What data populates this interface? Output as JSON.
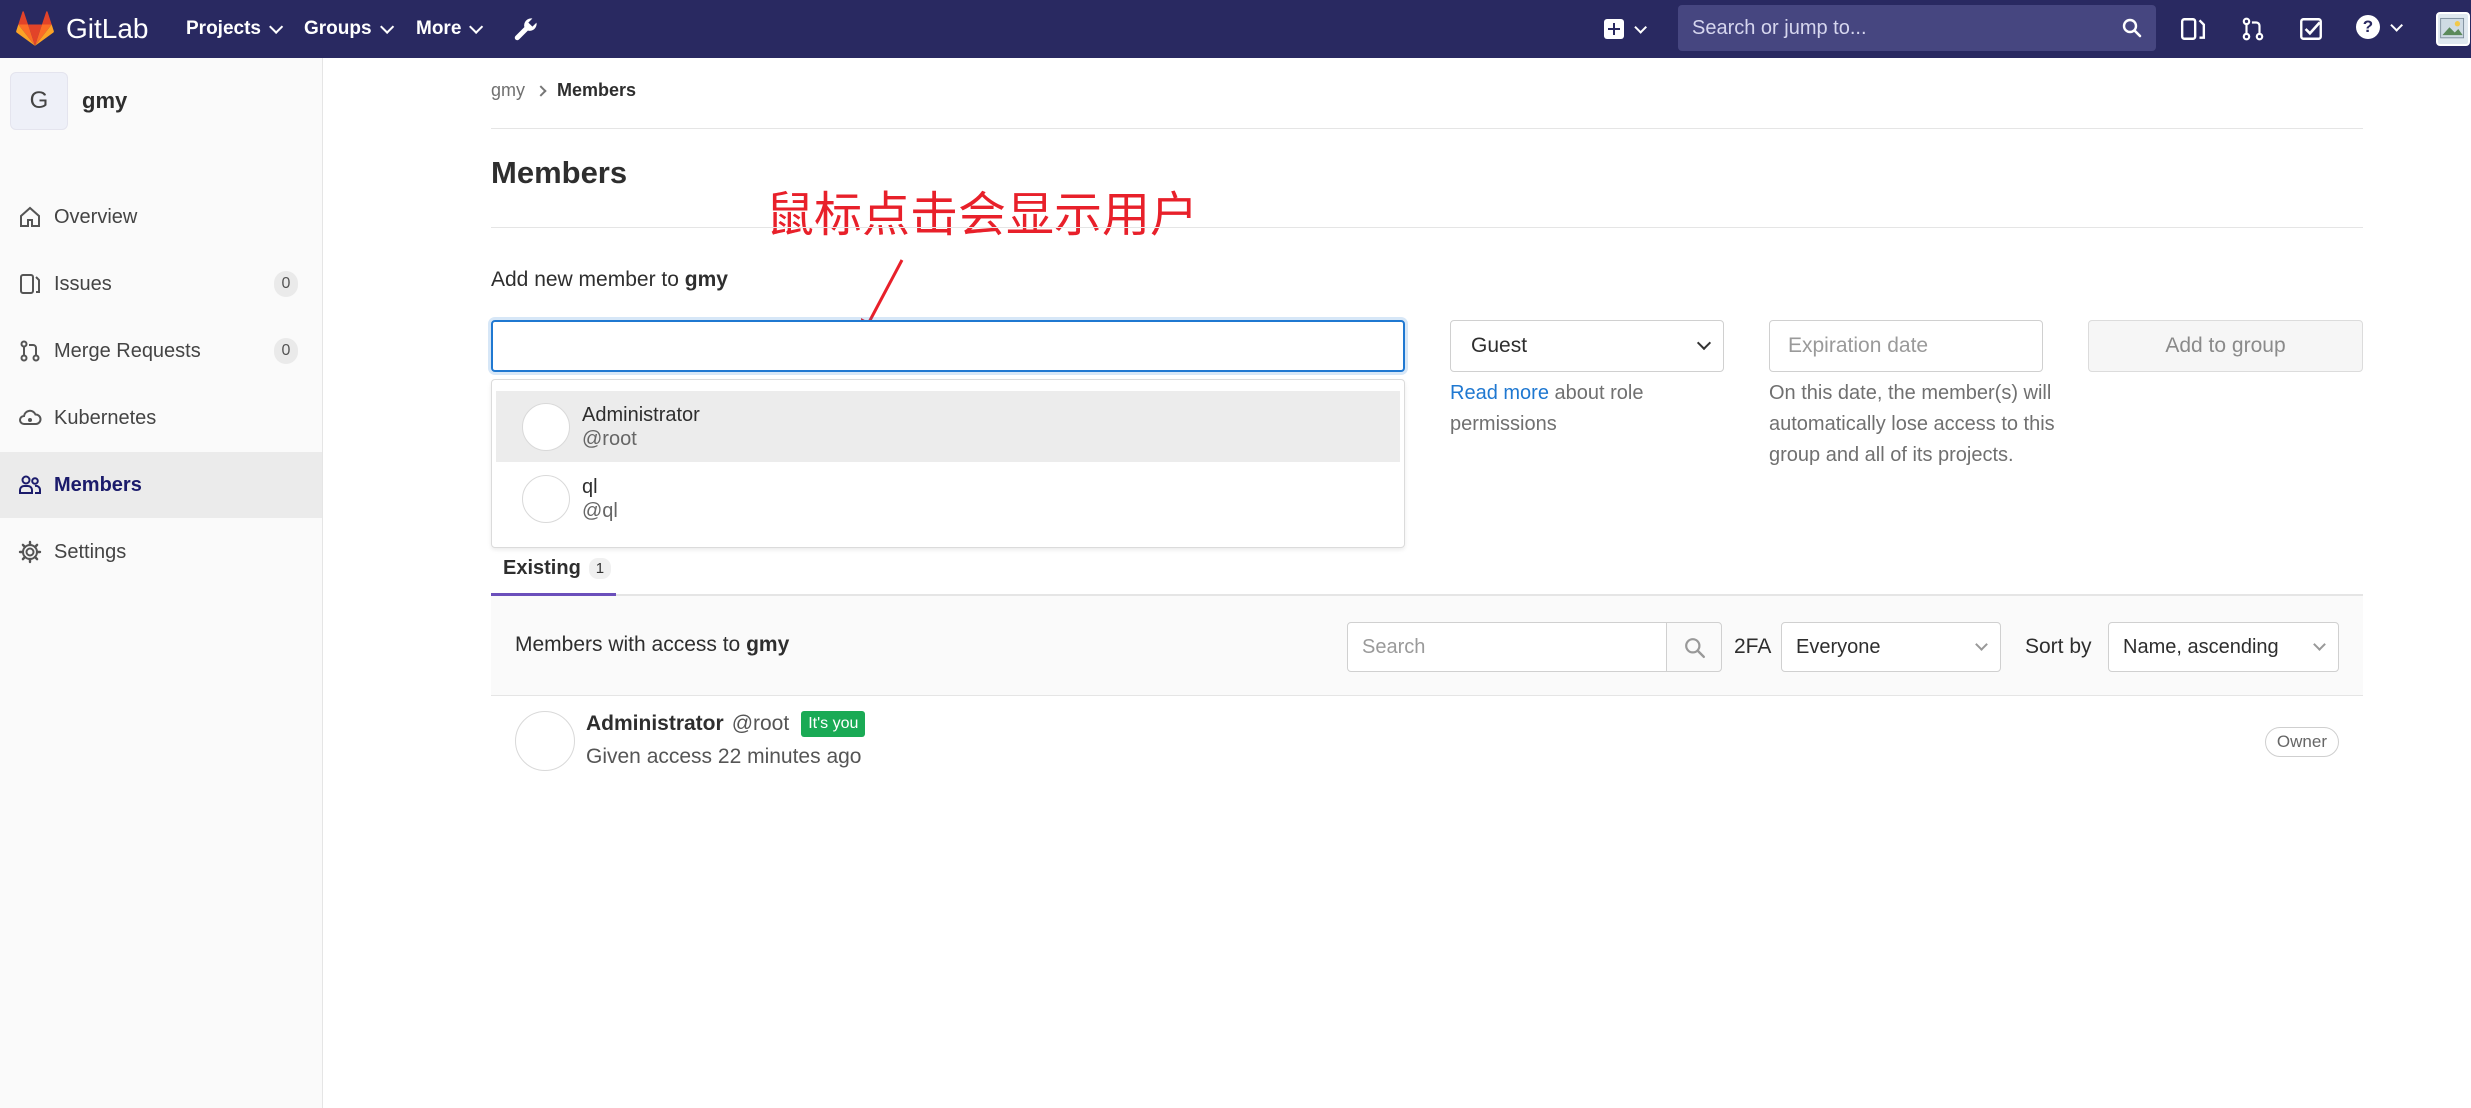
{
  "navbar": {
    "brand": "GitLab",
    "projects": "Projects",
    "groups": "Groups",
    "more": "More",
    "search_placeholder": "Search or jump to...",
    "bg_color": "#292961"
  },
  "sidebar": {
    "group_initial": "G",
    "group_name": "gmy",
    "items": [
      {
        "label": "Overview",
        "icon": "home-icon"
      },
      {
        "label": "Issues",
        "icon": "issues-icon",
        "count": "0"
      },
      {
        "label": "Merge Requests",
        "icon": "merge-request-icon",
        "count": "0"
      },
      {
        "label": "Kubernetes",
        "icon": "cloud-gear-icon"
      },
      {
        "label": "Members",
        "icon": "users-icon",
        "active": true
      },
      {
        "label": "Settings",
        "icon": "gear-icon"
      }
    ]
  },
  "breadcrumb": {
    "parent": "gmy",
    "current": "Members"
  },
  "page": {
    "title": "Members",
    "annotation": "鼠标点击会显示用户",
    "add_label_prefix": "Add new member to ",
    "add_label_group": "gmy"
  },
  "add_form": {
    "search_value": "",
    "suggestions": [
      {
        "name": "Administrator",
        "username": "@root"
      },
      {
        "name": "ql",
        "username": "@ql"
      }
    ],
    "role_value": "Guest",
    "role_help_link": "Read more",
    "role_help_text": " about role permissions",
    "expiration_placeholder": "Expiration date",
    "expiration_help": "On this date, the member(s) will automatically lose access to this group and all of its projects.",
    "add_button": "Add to group"
  },
  "tabs": {
    "existing_label": "Existing",
    "existing_count": "1"
  },
  "filter": {
    "label_prefix": "Members with access to ",
    "label_group": "gmy",
    "search_placeholder": "Search",
    "twofa_label": "2FA",
    "twofa_value": "Everyone",
    "sort_label": "Sort by",
    "sort_value": "Name, ascending"
  },
  "members": [
    {
      "name": "Administrator",
      "username": "@root",
      "badge": "It's you",
      "given": "Given access 22 minutes ago",
      "role": "Owner"
    }
  ],
  "colors": {
    "accent": "#1f78d1",
    "annotation": "#e8202a",
    "success": "#1aaa55",
    "tab_underline": "#6b4fbb"
  }
}
